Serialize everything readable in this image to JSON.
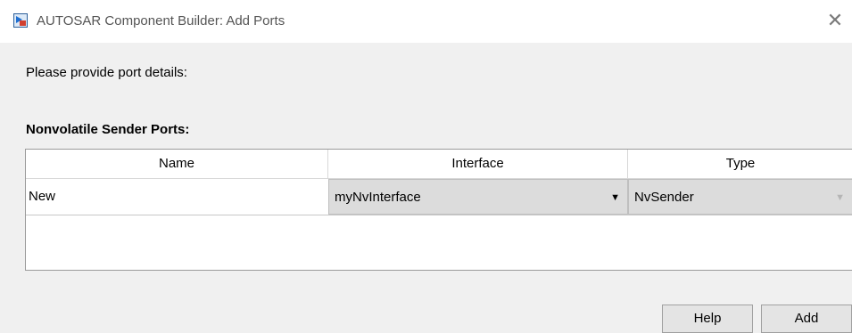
{
  "window": {
    "title": "AUTOSAR Component Builder: Add Ports"
  },
  "prompt": "Please provide port details:",
  "section": {
    "label": "Nonvolatile Sender Ports:"
  },
  "table": {
    "columns": [
      "Name",
      "Interface",
      "Type"
    ],
    "rows": [
      {
        "name": "New",
        "interface": "myNvInterface",
        "type": "NvSender"
      }
    ]
  },
  "buttons": {
    "help": "Help",
    "add": "Add"
  }
}
